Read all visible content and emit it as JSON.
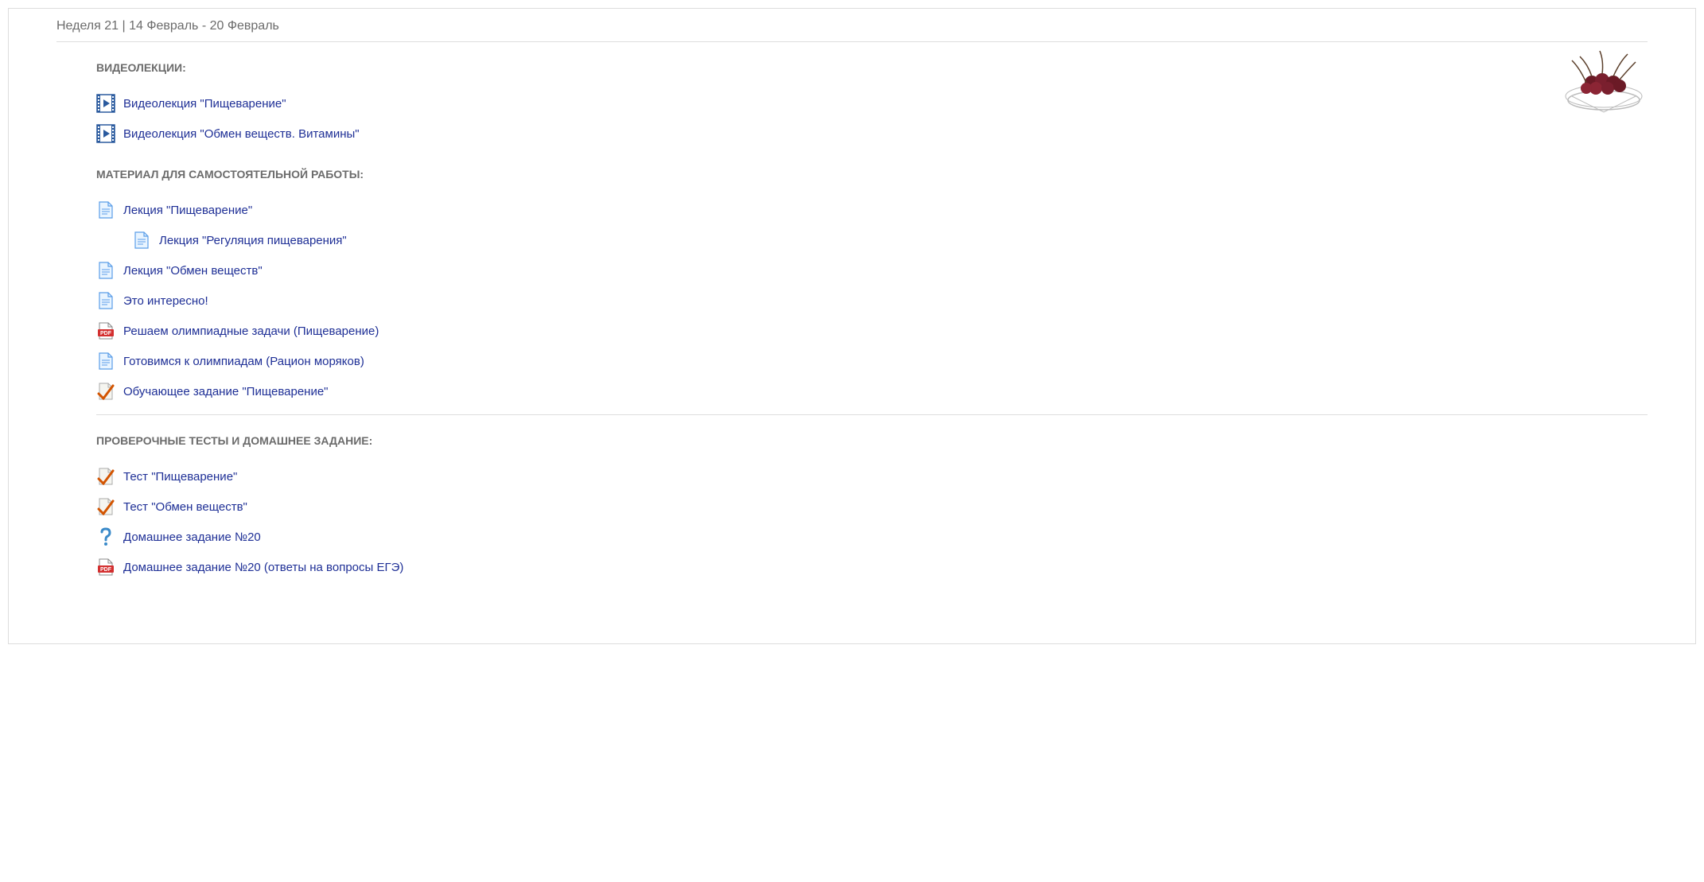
{
  "header": {
    "week_title": "Неделя 21 | 14 Февраль - 20 Февраль"
  },
  "sections": {
    "videos": {
      "heading": "ВИДЕОЛЕКЦИИ:",
      "items": [
        {
          "label": "Видеолекция \"Пищеварение\""
        },
        {
          "label": "Видеолекция \"Обмен веществ. Витамины\""
        }
      ]
    },
    "materials": {
      "heading": "МАТЕРИАЛ ДЛЯ САМОСТОЯТЕЛЬНОЙ РАБОТЫ:",
      "items": [
        {
          "label": "Лекция \"Пищеварение\"",
          "icon": "doc"
        },
        {
          "label": "Лекция \"Регуляция пищеварения\"",
          "icon": "doc",
          "indent": true
        },
        {
          "label": "Лекция \"Обмен веществ\"",
          "icon": "doc"
        },
        {
          "label": "Это интересно!",
          "icon": "doc"
        },
        {
          "label": "Решаем олимпиадные задачи (Пищеварение)",
          "icon": "pdf"
        },
        {
          "label": "Готовимся к олимпиадам (Рацион моряков)",
          "icon": "doc"
        },
        {
          "label": "Обучающее задание \"Пищеварение\"",
          "icon": "quiz"
        }
      ]
    },
    "tests": {
      "heading": "ПРОВЕРОЧНЫЕ ТЕСТЫ И ДОМАШНЕЕ ЗАДАНИЕ:",
      "items": [
        {
          "label": "Тест \"Пищеварение\"",
          "icon": "quiz"
        },
        {
          "label": "Тест \"Обмен веществ\"",
          "icon": "quiz"
        },
        {
          "label": "Домашнее задание №20",
          "icon": "question"
        },
        {
          "label": "Домашнее задание №20 (ответы на вопросы ЕГЭ)",
          "icon": "pdf"
        }
      ]
    }
  }
}
